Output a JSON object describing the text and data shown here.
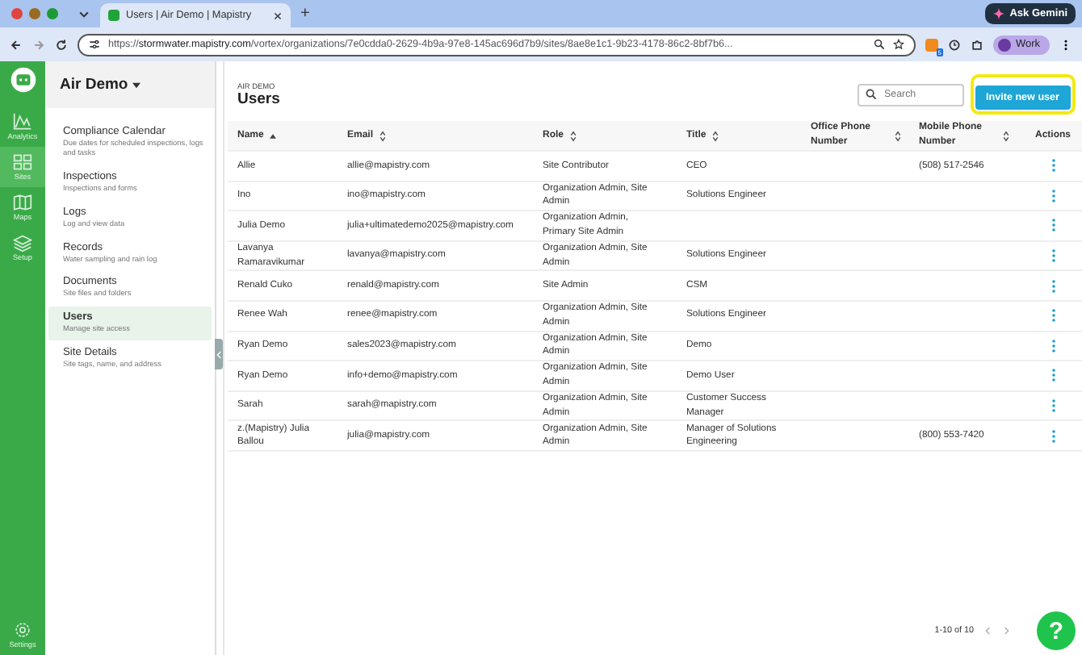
{
  "browser": {
    "tab_title": "Users | Air Demo | Mapistry",
    "new_tab": "+",
    "ask_button": "Ask Gemini",
    "url": "https://**stormwater.mapistry.com**/vortex/organizations/7e0cdda0-2629-4b9a-97e8-145ac696d7b9/sites/8ae8e1c1-9b23-4178-86c2-8bf7b6...",
    "profile": "Work",
    "extension_badge": "5"
  },
  "rail": [
    {
      "label": "Analytics",
      "kind": "analytics",
      "selected": false
    },
    {
      "label": "Sites",
      "kind": "sites",
      "selected": true
    },
    {
      "label": "Maps",
      "kind": "maps",
      "selected": false
    },
    {
      "label": "Setup",
      "kind": "setup",
      "selected": false
    }
  ],
  "rail_bottom": {
    "label": "Settings"
  },
  "sidebar": {
    "title": "Air Demo",
    "items": [
      {
        "label": "Compliance Calendar",
        "description": "Due dates for scheduled inspections, logs and tasks",
        "selected": false
      },
      {
        "label": "Inspections",
        "description": "Inspections and forms",
        "selected": false
      },
      {
        "label": "Logs",
        "description": "Log and view data",
        "selected": false
      },
      {
        "label": "Records",
        "description": "Water sampling and rain log",
        "selected": false
      },
      {
        "label": "Documents",
        "description": "Site files and folders",
        "selected": false
      },
      {
        "label": "Users",
        "description": "Manage site access",
        "selected": true
      },
      {
        "label": "Site Details",
        "description": "Site tags, name, and address",
        "selected": false
      }
    ]
  },
  "header": {
    "breadcrumb": "AIR DEMO",
    "title": "Users",
    "search": {
      "placeholder": "Search"
    },
    "invite_button": "Invite new user"
  },
  "table": {
    "columns": [
      {
        "label": "Name",
        "sortable": true,
        "sorted": true
      },
      {
        "label": "Email",
        "sortable": true,
        "sorted": false
      },
      {
        "label": "Role",
        "sortable": true,
        "sorted": false
      },
      {
        "label": "Title",
        "sortable": true,
        "sorted": false
      },
      {
        "label": "Office Phone Number",
        "sortable": true,
        "sorted": false
      },
      {
        "label": "Mobile Phone Number",
        "sortable": true,
        "sorted": false
      },
      {
        "label": "Actions",
        "sortable": false
      }
    ],
    "rows": [
      [
        "Allie",
        "allie@mapistry.com",
        "Site Contributor",
        "CEO",
        "",
        "(508) 517-2546"
      ],
      [
        "Ino",
        "ino@mapistry.com",
        "Organization Admin, Site Admin",
        "Solutions Engineer",
        "",
        ""
      ],
      [
        "Julia Demo",
        "julia+ultimatedemo2025@mapistry.com",
        "Organization Admin, Primary Site Admin",
        "",
        "",
        ""
      ],
      [
        "Lavanya Ramaravikumar",
        "lavanya@mapistry.com",
        "Organization Admin, Site Admin",
        "Solutions Engineer",
        "",
        ""
      ],
      [
        "Renald Cuko",
        "renald@mapistry.com",
        "Site Admin",
        "CSM",
        "",
        ""
      ],
      [
        "Renee Wah",
        "renee@mapistry.com",
        "Organization Admin, Site Admin",
        "Solutions Engineer",
        "",
        ""
      ],
      [
        "Ryan Demo",
        "sales2023@mapistry.com",
        "Organization Admin, Site Admin",
        "Demo",
        "",
        ""
      ],
      [
        "Ryan Demo",
        "info+demo@mapistry.com",
        "Organization Admin, Site Admin",
        "Demo User",
        "",
        ""
      ],
      [
        "Sarah",
        "sarah@mapistry.com",
        "Organization Admin, Site Admin",
        "Customer Success Manager",
        "",
        ""
      ],
      [
        "z.(Mapistry) Julia Ballou",
        "julia@mapistry.com",
        "Organization Admin, Site Admin",
        "Manager of Solutions Engineering",
        "",
        "(800) 553-7420"
      ]
    ]
  },
  "pagination": {
    "range": "1-10 of 10"
  },
  "help_button": "?"
}
